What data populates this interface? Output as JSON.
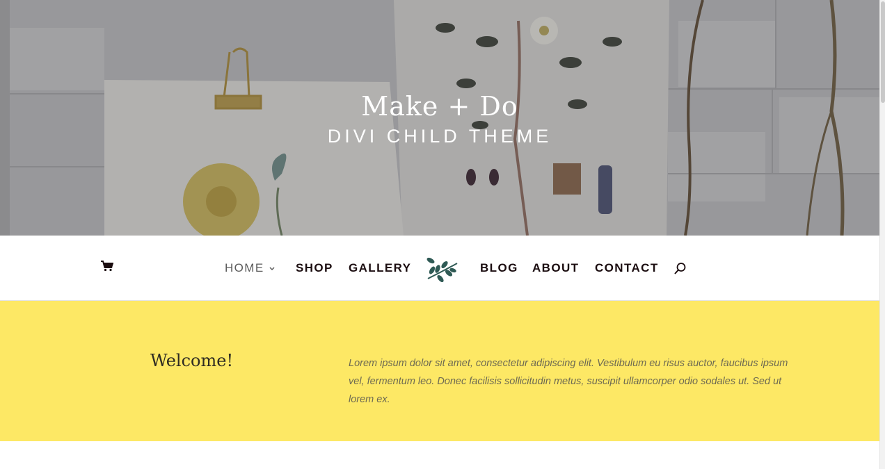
{
  "hero": {
    "title": "Make + Do",
    "subtitle": "DIVI CHILD THEME"
  },
  "nav": {
    "cart_icon": "shopping-cart-icon",
    "items": [
      {
        "label": "HOME",
        "active": true,
        "has_submenu": true
      },
      {
        "label": "SHOP"
      },
      {
        "label": "GALLERY"
      },
      {
        "label": "BLOG"
      },
      {
        "label": "ABOUT"
      },
      {
        "label": "CONTACT"
      }
    ],
    "logo_icon": "leaf-branch-logo-icon",
    "search_icon": "search-icon",
    "text_color": "#1b0d10"
  },
  "welcome": {
    "heading": "Welcome!",
    "text": "Lorem ipsum dolor sit amet, consectetur adipiscing elit. Vestibulum eu risus auctor, faucibus ipsum vel, fermentum leo. Donec facilisis sollicitudin metus, suscipit ullamcorper odio sodales ut. Sed ut lorem ex.",
    "background_color": "#fde865"
  }
}
